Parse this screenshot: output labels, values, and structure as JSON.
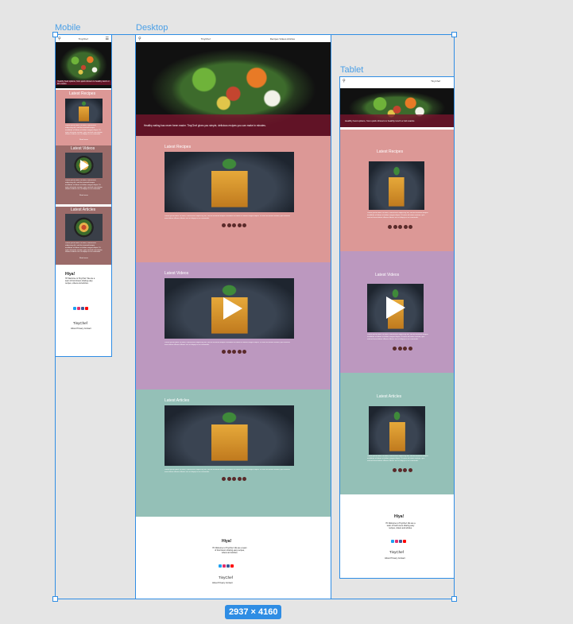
{
  "labels": {
    "mobile": "Mobile",
    "desktop": "Desktop",
    "tablet": "Tablet"
  },
  "canvas_size": "2937 × 4160",
  "colors": {
    "selection": "#2f8de4",
    "recipes": "#dc9896",
    "videos": "#bc98bf",
    "articles": "#94c0b7",
    "articles_mobile": "#9b6b69",
    "videos_mobile": "#9b6b69",
    "hero_band": "#781430"
  },
  "nav": {
    "logo": "TinyChef",
    "desktop_links": "Recipes   Videos   Articles"
  },
  "hero": {
    "desktop_text": "Healthy eating has never been easier. TinyChef gives you simple, delicious recipes you can make in minutes.",
    "tablet_text": "Healthy food options, from quick dinners to healthy lunch or kid snacks",
    "mobile_text": "Healthy food options, from quick dinners to healthy lunch or kid snacks"
  },
  "sections": {
    "recipes": "Latest Recipes",
    "videos": "Latest Videos",
    "articles": "Latest Articles"
  },
  "desc": "Lorem ipsum dolor sit amet, consectetur adipiscing elit, sed do eiusmod tempor incididunt ut labore et dolore magna aliqua. Ut enim ad minim veniam, quis nostrud exercitation ullamco laboris nisi ut aliquip ex ea commodo.",
  "read_more": "Read more",
  "footer": {
    "greeting": "Hiya!",
    "about": "Hi! Welcome to TinyChef. We are a team of food lovers sharing easy recipes, videos and articles.",
    "brand": "TinyChef",
    "links": "About  Privacy  Contact"
  }
}
